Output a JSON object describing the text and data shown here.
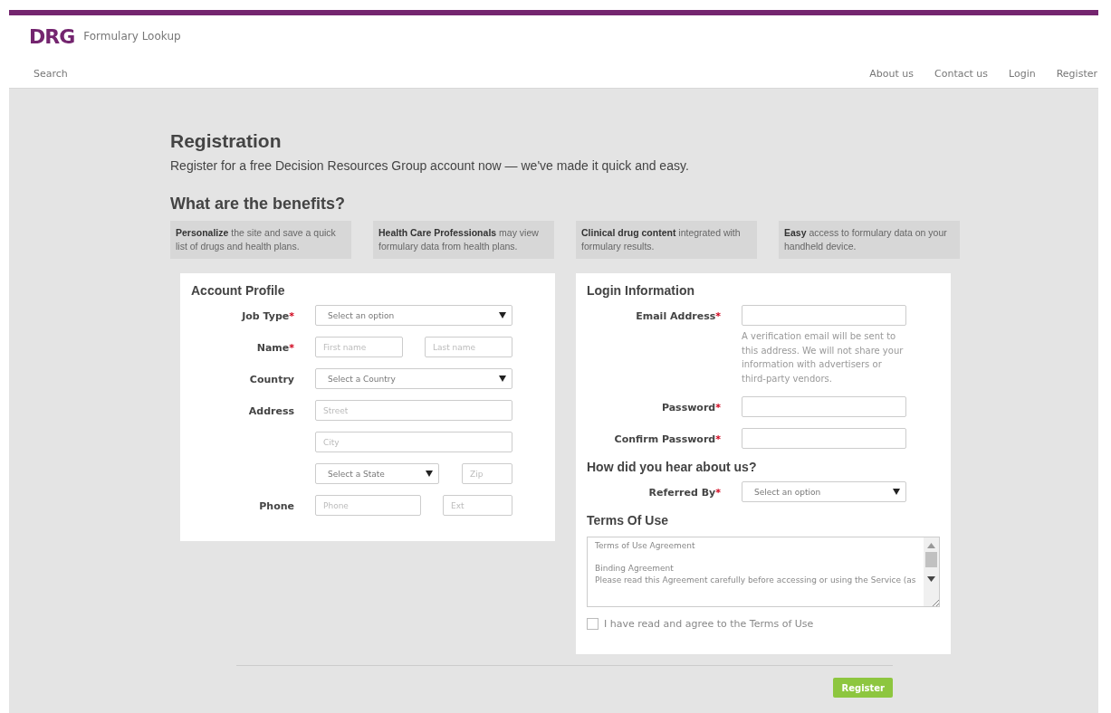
{
  "header": {
    "logo": "DRG",
    "app_title": "Formulary Lookup",
    "nav_left": "Search",
    "nav_right": [
      "About us",
      "Contact us",
      "Login",
      "Register"
    ]
  },
  "registration": {
    "title": "Registration",
    "intro": "Register for a free Decision Resources Group account now — we've made it quick and easy.",
    "benefits_title": "What are the benefits?",
    "benefits": [
      "**Personalize** the site and save a quick list of drugs and health plans.",
      "**Health Care Professionals** may view formulary data from health plans.",
      "**Clinical drug content** integrated with formulary results.",
      "**Easy** access to formulary data on your handheld device."
    ]
  },
  "account_profile": {
    "title": "Account Profile",
    "rows": [
      {
        "label": "Job Type",
        "mark": "*",
        "controls": [
          {
            "kind": "select",
            "placeholder": "Select an option"
          }
        ]
      },
      {
        "label": "Name",
        "mark": "*",
        "controls": [
          {
            "kind": "input",
            "placeholder": "First name"
          },
          {
            "kind": "input",
            "placeholder": "Last name"
          }
        ]
      },
      {
        "label": "Country",
        "controls": [
          {
            "kind": "select",
            "placeholder": "Select a Country"
          }
        ]
      },
      {
        "label": "Address",
        "controls": [
          {
            "kind": "input",
            "placeholder": "Street"
          }
        ]
      },
      {
        "controls": [
          {
            "kind": "input",
            "placeholder": "City"
          }
        ]
      },
      {
        "controls": [
          {
            "kind": "select",
            "placeholder": "Select a State"
          },
          {
            "kind": "input",
            "placeholder": "Zip"
          }
        ]
      },
      {
        "label": "Phone",
        "controls": [
          {
            "kind": "input",
            "placeholder": "Phone"
          },
          {
            "kind": "input",
            "placeholder": "Ext"
          }
        ]
      }
    ]
  },
  "login_information": {
    "title": "Login Information",
    "rows": [
      {
        "label": "Email Address",
        "mark": "*",
        "controls": [
          {
            "kind": "input"
          }
        ],
        "hint": "A verification email will be sent to this address. We will not share your information with advertisers or third-party vendors."
      },
      {
        "label": "Password",
        "mark": "*",
        "controls": [
          {
            "kind": "input"
          }
        ]
      },
      {
        "label": "Confirm Password",
        "mark": "*",
        "controls": [
          {
            "kind": "input"
          }
        ]
      }
    ]
  },
  "referral": {
    "title": "How did you hear about us?",
    "rows": [
      {
        "label": "Referred By",
        "mark": "*",
        "controls": [
          {
            "kind": "select",
            "placeholder": "Select an option"
          }
        ]
      }
    ]
  },
  "terms": {
    "title": "Terms Of Use",
    "paragraphs": [
      [
        "Terms of Use Agreement"
      ],
      [
        "Binding Agreement",
        "Please read this Agreement carefully before accessing or using the Service (as"
      ]
    ],
    "agree": {
      "label": "I have read and agree to the Terms of Use",
      "checked": false
    }
  },
  "submit": "Register"
}
